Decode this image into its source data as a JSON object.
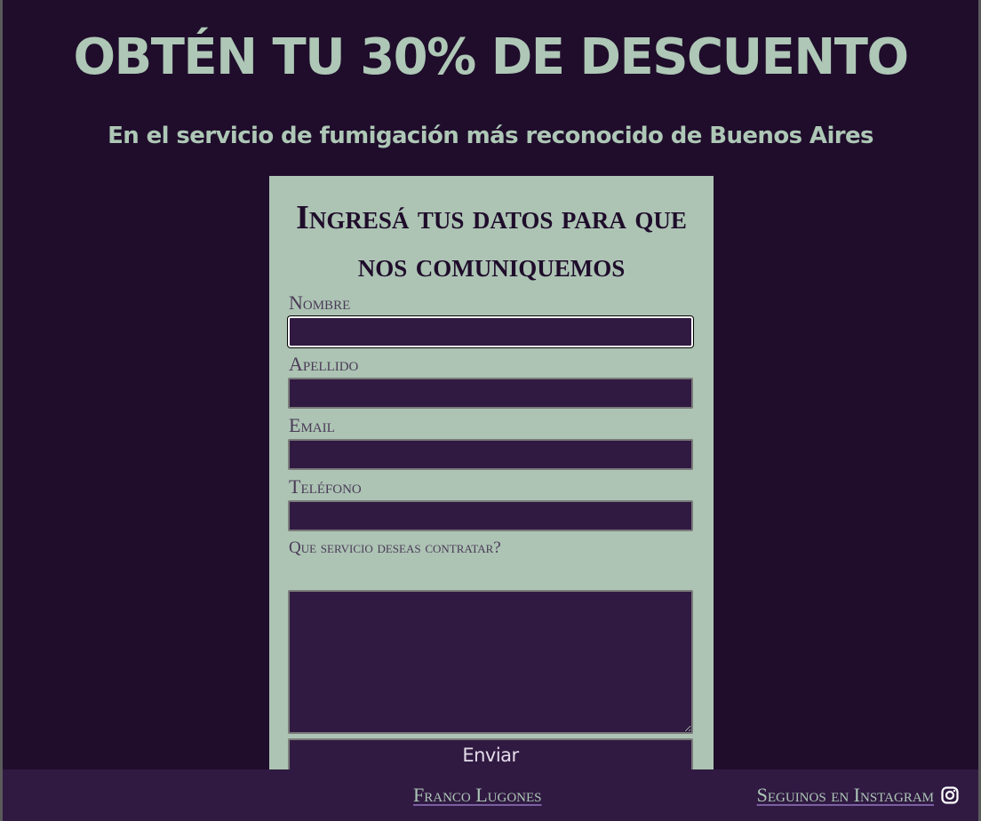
{
  "header": {
    "title": "OBTÉN TU 30% DE DESCUENTO",
    "subtitle": "En el servicio de fumigación más reconocido de Buenos Aires"
  },
  "form": {
    "title": "Ingresá tus datos para que nos comuniquemos",
    "fields": [
      {
        "label": "Nombre",
        "value": ""
      },
      {
        "label": "Apellido",
        "value": ""
      },
      {
        "label": "Email",
        "value": ""
      },
      {
        "label": "Teléfono",
        "value": ""
      }
    ],
    "service_question": "Que servicio deseas contratar?",
    "service_value": "",
    "submit_label": "Enviar"
  },
  "footer": {
    "author": "Franco Lugones",
    "instagram_label": "Seguinos en Instagram",
    "instagram_icon": "instagram-icon"
  },
  "colors": {
    "background": "#1f0d2b",
    "accent": "#aec7b6",
    "input_background": "#301a42",
    "footer_background": "#301a42"
  }
}
